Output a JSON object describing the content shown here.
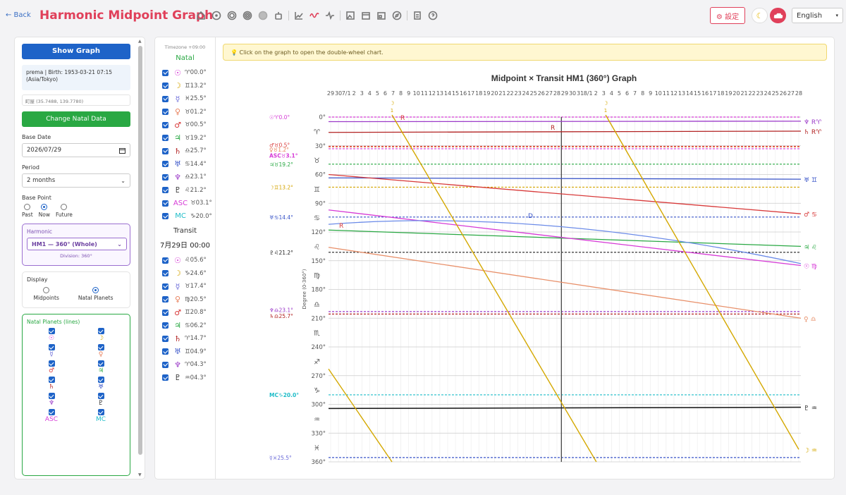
{
  "header": {
    "back_label": "← Back",
    "title": "Harmonic Midpoint Graph",
    "settings_label": "⚙ 設定",
    "language": "English",
    "toolbar_icons": [
      "home-icon",
      "circle-dot-icon",
      "double-circle-icon",
      "target-icon",
      "filled-circle-icon",
      "robot-icon",
      "line-chart-icon",
      "wave-icon",
      "pulse-icon",
      "image-icon",
      "calendar-icon",
      "calendar-alt-icon",
      "compass-icon",
      "clipboard-icon",
      "help-icon"
    ]
  },
  "controls": {
    "show_graph": "Show Graph",
    "profile": "prema | Birth: 1953-03-21 07:15 (Asia/Tokyo)",
    "coordinates": "町屋 (35.7488, 139.7780)",
    "change_natal": "Change Natal Data",
    "base_date_label": "Base Date",
    "base_date": "2026/07/29",
    "period_label": "Period",
    "period": "2 months",
    "base_point_label": "Base Point",
    "base_points": [
      "Past",
      "Now",
      "Future"
    ],
    "base_point_selected": "Now",
    "harmonic_label": "Harmonic",
    "harmonic_value": "HM1 — 360° (Whole)",
    "harmonic_division": "Division: 360°",
    "display_label": "Display",
    "display_options": [
      "Midpoints",
      "Natal Planets"
    ],
    "display_selected": "Natal Planets",
    "natal_lines_label": "Natal Planets (lines)",
    "natal_lines": [
      {
        "sym": "☉",
        "color": "#d63ad6"
      },
      {
        "sym": "☽",
        "color": "#d4a400"
      },
      {
        "sym": "☿",
        "color": "#6a6ad8"
      },
      {
        "sym": "♀",
        "color": "#e87f5a"
      },
      {
        "sym": "♂",
        "color": "#d83a3a"
      },
      {
        "sym": "♃",
        "color": "#29a843"
      },
      {
        "sym": "♄",
        "color": "#b22222"
      },
      {
        "sym": "♅",
        "color": "#3a55c8"
      },
      {
        "sym": "♆",
        "color": "#9b3ac8"
      },
      {
        "sym": "♇",
        "color": "#222222"
      },
      {
        "sym": "ASC",
        "color": "#d63ad6"
      },
      {
        "sym": "MC",
        "color": "#1ebcc8"
      }
    ]
  },
  "planet_list": {
    "timezone": "Timezone +09:00",
    "natal_title": "Natal",
    "natal": [
      {
        "sym": "☉",
        "pos": "♈00.0°",
        "color": "#d63ad6"
      },
      {
        "sym": "☽",
        "pos": "♊13.2°",
        "color": "#d4a400"
      },
      {
        "sym": "☿",
        "pos": "♓25.5°",
        "color": "#6a6ad8"
      },
      {
        "sym": "♀",
        "pos": "♉01.2°",
        "color": "#e87f5a"
      },
      {
        "sym": "♂",
        "pos": "♉00.5°",
        "color": "#d83a3a"
      },
      {
        "sym": "♃",
        "pos": "♉19.2°",
        "color": "#29a843"
      },
      {
        "sym": "♄",
        "pos": "♎25.7°",
        "color": "#b22222"
      },
      {
        "sym": "♅",
        "pos": "♋14.4°",
        "color": "#3a55c8"
      },
      {
        "sym": "♆",
        "pos": "♎23.1°",
        "color": "#9b3ac8"
      },
      {
        "sym": "♇",
        "pos": "♌21.2°",
        "color": "#222222"
      },
      {
        "sym": "ASC",
        "pos": "♉03.1°",
        "color": "#d63ad6"
      },
      {
        "sym": "MC",
        "pos": "♑20.0°",
        "color": "#1ebcc8"
      }
    ],
    "transit_title": "Transit",
    "transit_date": "7月29日 00:00",
    "transit": [
      {
        "sym": "☉",
        "pos": "♌05.6°",
        "color": "#d63ad6"
      },
      {
        "sym": "☽",
        "pos": "♑24.6°",
        "color": "#d4a400"
      },
      {
        "sym": "☿",
        "pos": "♉17.4°",
        "color": "#6a6ad8"
      },
      {
        "sym": "♀",
        "pos": "♍20.5°",
        "color": "#e87f5a"
      },
      {
        "sym": "♂",
        "pos": "♊20.8°",
        "color": "#d83a3a"
      },
      {
        "sym": "♃",
        "pos": "♋06.2°",
        "color": "#29a843"
      },
      {
        "sym": "♄",
        "pos": "♈14.7°",
        "color": "#b22222"
      },
      {
        "sym": "♅",
        "pos": "♊04.9°",
        "color": "#3a55c8"
      },
      {
        "sym": "♆",
        "pos": "♈04.3°",
        "color": "#9b3ac8"
      },
      {
        "sym": "♇",
        "pos": "♒04.3°",
        "color": "#222222"
      }
    ]
  },
  "chart": {
    "hint": "💡 Click on the graph to open the double-wheel chart.",
    "title": "Midpoint × Transit  HM1 (360°) Graph",
    "ylabel": "Degree (0-360°)",
    "date_labels": [
      "29",
      "30",
      "7/1",
      "2",
      "3",
      "4",
      "5",
      "6",
      "7",
      "8",
      "9",
      "10",
      "11",
      "12",
      "13",
      "14",
      "15",
      "16",
      "17",
      "18",
      "19",
      "20",
      "21",
      "22",
      "23",
      "24",
      "25",
      "26",
      "27",
      "28",
      "29",
      "30",
      "31",
      "8/1",
      "2",
      "3",
      "4",
      "5",
      "6",
      "7",
      "8",
      "9",
      "10",
      "11",
      "12",
      "13",
      "14",
      "15",
      "16",
      "17",
      "18",
      "19",
      "20",
      "21",
      "22",
      "23",
      "24",
      "25",
      "26",
      "27",
      "28"
    ],
    "ytick_labels": [
      "0°",
      "30°",
      "60°",
      "90°",
      "120°",
      "150°",
      "180°",
      "210°",
      "240°",
      "270°",
      "300°",
      "330°",
      "360°"
    ],
    "sign_glyphs": [
      "♈",
      "♉",
      "♊",
      "♋",
      "♌",
      "♍",
      "♎",
      "♏",
      "♐",
      "♑",
      "♒",
      "♓"
    ],
    "natal_labels": [
      {
        "text": "☉♈0.0°",
        "color": "#d63ad6"
      },
      {
        "text": "♂♉0.5°",
        "color": "#d83a3a"
      },
      {
        "text": "♀♉1.2°",
        "color": "#e87f5a"
      },
      {
        "text": "ASC♉3.1°",
        "color": "#d63ad6"
      },
      {
        "text": "♃♉19.2°",
        "color": "#29a843"
      },
      {
        "text": "☽♊13.2°",
        "color": "#d4a400"
      },
      {
        "text": "♅♋14.4°",
        "color": "#3a55c8"
      },
      {
        "text": "♇♌21.2°",
        "color": "#222222"
      },
      {
        "text": "♆♎23.1°",
        "color": "#9b3ac8"
      },
      {
        "text": "♄♎25.7°",
        "color": "#b22222"
      },
      {
        "text": "MC♑20.0°",
        "color": "#1ebcc8"
      },
      {
        "text": "☿♓25.5°",
        "color": "#6a6ad8"
      }
    ],
    "right_labels": [
      "♆ R♈",
      "♄ R♈",
      "♂ ♋",
      "♅ ♊",
      "♃ ♌",
      "☉ ♍",
      "♀ ♎",
      "♇ ♒",
      "☽ ♒"
    ],
    "moon_marker": "☽",
    "moon_count": "1",
    "markers": [
      "R",
      "R",
      "D",
      "R"
    ]
  },
  "chart_data": {
    "type": "line",
    "title": "Midpoint × Transit  HM1 (360°) Graph",
    "ylabel": "Degree (0-360°)",
    "ylim": [
      0,
      360
    ],
    "x_range": [
      "6/29",
      "8/28"
    ],
    "natal_lines_deg": {
      "Sun": 0.0,
      "Mars": 30.5,
      "Venus": 31.2,
      "ASC": 33.1,
      "Jupiter": 49.2,
      "Moon": 73.2,
      "Uranus": 104.4,
      "Pluto": 141.2,
      "Neptune": 203.1,
      "Saturn": 205.7,
      "MC": 290.0,
      "Mercury": 355.5
    },
    "transit_series": [
      {
        "name": "♆",
        "start_deg": 4.8,
        "end_deg": 4.3
      },
      {
        "name": "♄",
        "start_deg": 16.0,
        "end_deg": 14.7
      },
      {
        "name": "♅",
        "start_deg": 63.5,
        "end_deg": 64.9
      },
      {
        "name": "♂",
        "start_deg": 60.0,
        "end_deg": 101.0
      },
      {
        "name": "♃",
        "start_deg": 118.0,
        "end_deg": 135.0
      },
      {
        "name": "☉",
        "start_deg": 97.0,
        "end_deg": 155.0
      },
      {
        "name": "☿",
        "start_deg": 112.0,
        "end_deg": 153.0
      },
      {
        "name": "♀",
        "start_deg": 136.0,
        "end_deg": 210.0
      },
      {
        "name": "♇",
        "start_deg": 304.3,
        "end_deg": 303.0
      }
    ]
  }
}
